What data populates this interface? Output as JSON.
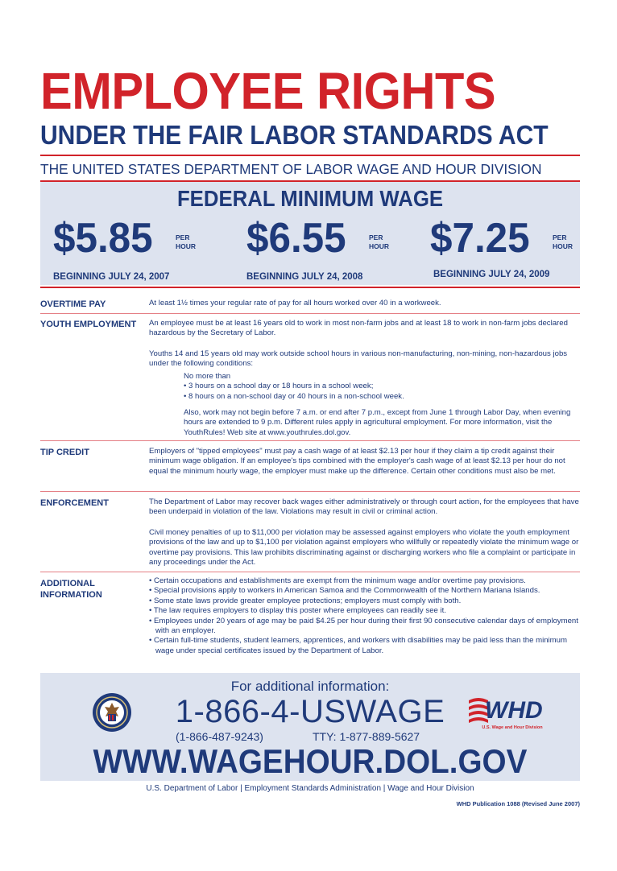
{
  "header": {
    "title": "EMPLOYEE RIGHTS",
    "subtitle": "UNDER THE FAIR LABOR STANDARDS ACT",
    "department": "THE UNITED STATES DEPARTMENT OF LABOR WAGE AND HOUR DIVISION"
  },
  "wage": {
    "heading": "FEDERAL MINIMUM WAGE",
    "rates": [
      {
        "amount": "$5.85",
        "per": "PER",
        "hour": "HOUR",
        "begin": "BEGINNING JULY 24, 2007"
      },
      {
        "amount": "$6.55",
        "per": "PER",
        "hour": "HOUR",
        "begin": "BEGINNING JULY 24, 2008"
      },
      {
        "amount": "$7.25",
        "per": "PER",
        "hour": "HOUR",
        "begin": "BEGINNING JULY 24, 2009"
      }
    ]
  },
  "sections": {
    "overtime": {
      "heading": "OVERTIME PAY",
      "text": "At least 1½ times your regular rate of pay for all hours worked over 40 in a workweek."
    },
    "youth": {
      "heading": "YOUTH EMPLOYMENT",
      "p1": "An employee must be at least 16 years old to work in most non-farm jobs and at least 18 to work in non-farm jobs declared hazardous by the Secretary of Labor.",
      "p2": "Youths 14 and 15 years old may work outside school hours in various non-manufacturing, non-mining, non-hazardous jobs under the following conditions:",
      "nomore": "No more than",
      "cond1": "3 hours on a school day or 18 hours in a school week;",
      "cond2": "8 hours on a non-school day or 40 hours in a non-school week.",
      "p3": "Also, work may not begin before 7 a.m. or end after 7 p.m., except from June 1 through Labor Day, when evening hours are extended to 9 p.m. Different rules apply in agricultural employment. For more information, visit the YouthRules! Web site at www.youthrules.dol.gov."
    },
    "tip": {
      "heading": "TIP CREDIT",
      "text": "Employers of \"tipped employees\" must pay a cash wage of at least $2.13 per hour if they claim a tip credit against their minimum wage obligation. If an employee's tips combined with the employer's cash wage of at least $2.13 per hour do not equal the minimum hourly wage, the employer must make up the difference. Certain other conditions must also be met."
    },
    "enforcement": {
      "heading": "ENFORCEMENT",
      "p1": "The Department of Labor may recover back wages either administratively or through court action, for the employees that have been underpaid in violation of the law. Violations may result in civil or criminal action.",
      "p2": "Civil money penalties of up to $11,000 per violation may be assessed against employers who violate the youth employment provisions of the law and up to $1,100 per violation against employers who willfully or repeatedly violate the minimum wage or overtime pay provisions. This law prohibits discriminating against or discharging workers who file a complaint or participate in any proceedings under the Act."
    },
    "additional": {
      "heading": "ADDITIONAL INFORMATION",
      "items": [
        "Certain occupations and establishments are exempt from the minimum wage and/or overtime pay provisions.",
        "Special provisions apply to workers in American Samoa and the Commonwealth of the Northern Mariana Islands.",
        "Some state laws provide greater employee protections; employers must comply with both.",
        "The law requires employers to display this poster where employees can readily see it.",
        "Employees under 20 years of age may be paid $4.25 per hour during their first 90 consecutive calendar days of employment with an employer.",
        "Certain full-time students, student learners, apprentices, and workers with disabilities may be paid less than the minimum wage under special certificates issued by the Department of Labor."
      ]
    }
  },
  "contact": {
    "for_info": "For additional information:",
    "phone": "1-866-4-USWAGE",
    "phone_numeric": "(1-866-487-9243)",
    "tty": "TTY: 1-877-889-5627",
    "url": "WWW.WAGEHOUR.DOL.GOV",
    "whd_logo_text": "WHD",
    "whd_caption": "U.S. Wage and Hour Division"
  },
  "footer": {
    "line": "U.S. Department of Labor  |  Employment Standards Administration  |  Wage and Hour Division",
    "publication": "WHD Publication 1088 (Revised June 2007)"
  },
  "colors": {
    "red": "#d1232a",
    "blue": "#1f3a7a",
    "box": "#dde3ef"
  }
}
